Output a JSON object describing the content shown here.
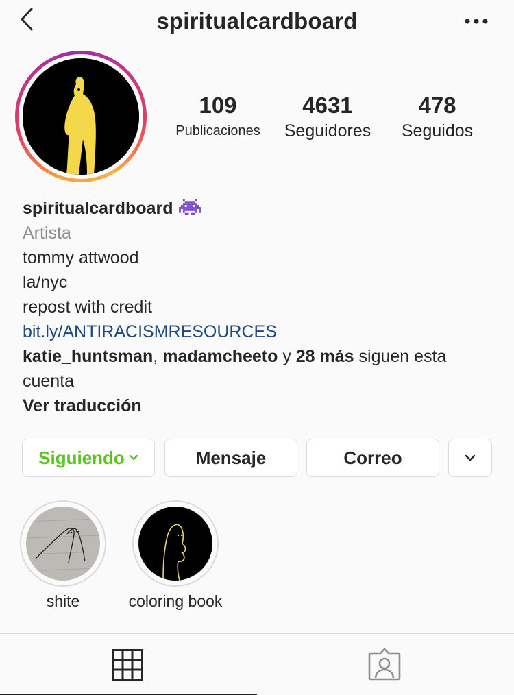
{
  "header": {
    "username": "spiritualcardboard",
    "back_icon": "chevron-left-icon",
    "more_icon": "more-horizontal-icon"
  },
  "stats": {
    "posts": {
      "value": "109",
      "label": "Publicaciones"
    },
    "followers": {
      "value": "4631",
      "label": "Seguidores"
    },
    "following": {
      "value": "478",
      "label": "Seguidos"
    }
  },
  "bio": {
    "name": "spiritualcardboard",
    "name_emoji": "alien-monster-icon",
    "category": "Artista",
    "lines": [
      "tommy attwood",
      "la/nyc",
      "repost with credit"
    ],
    "link": "bit.ly/ANTIRACISMRESOURCES",
    "followed_by": {
      "user1": "katie_huntsman",
      "separator": ",",
      "user2": "madamcheeto",
      "and": "y",
      "count": "28 más",
      "suffix": "siguen esta cuenta"
    },
    "translate": "Ver traducción"
  },
  "actions": {
    "following": "Siguiendo",
    "message": "Mensaje",
    "email": "Correo"
  },
  "highlights": [
    {
      "label": "shite"
    },
    {
      "label": "coloring book"
    }
  ],
  "tabs": {
    "grid_icon": "grid-icon",
    "tagged_icon": "tagged-person-icon"
  },
  "colors": {
    "following_green": "#58c322",
    "link_blue": "#1c4a7e",
    "category_gray": "#8e8e8e",
    "border": "#dbdbdb",
    "avatar_figure_yellow": "#f3d94a"
  }
}
